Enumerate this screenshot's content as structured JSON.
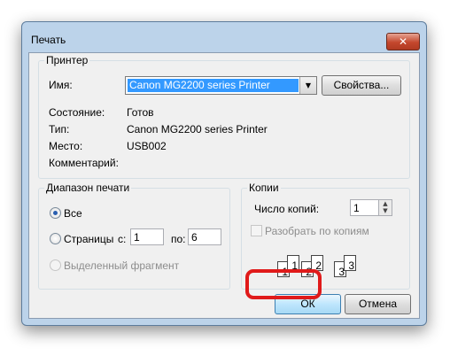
{
  "window": {
    "title": "Печать",
    "close_glyph": "✕"
  },
  "printer_group": {
    "legend": "Принтер",
    "name_label": "Имя:",
    "name_value": "Canon MG2200 series Printer",
    "properties_button": "Свойства...",
    "state_label": "Состояние:",
    "state_value": "Готов",
    "type_label": "Тип:",
    "type_value": "Canon MG2200 series Printer",
    "location_label": "Место:",
    "location_value": "USB002",
    "comment_label": "Комментарий:",
    "comment_value": ""
  },
  "range_group": {
    "legend": "Диапазон печати",
    "all_label": "Все",
    "pages_label": "Страницы",
    "from_label": "с:",
    "from_value": "1",
    "to_label": "по:",
    "to_value": "6",
    "selection_label": "Выделенный фрагмент",
    "selected": "all"
  },
  "copies_group": {
    "legend": "Копии",
    "count_label": "Число копий:",
    "count_value": "1",
    "collate_label": "Разобрать по копиям",
    "collate_checked": false,
    "collate_pages": [
      "1",
      "1",
      "2",
      "2",
      "3",
      "3"
    ]
  },
  "buttons": {
    "ok": "ОК",
    "cancel": "Отмена"
  },
  "colors": {
    "highlight": "#e01a1a",
    "title_bar": "#bcd3ea",
    "selection": "#3399ff"
  }
}
